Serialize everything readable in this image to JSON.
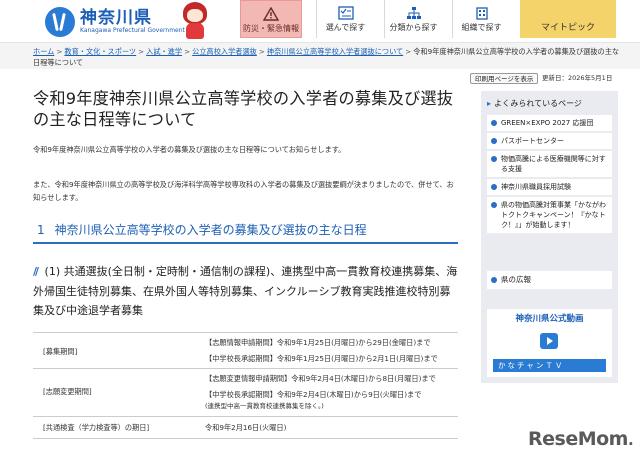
{
  "header": {
    "logo_jp": "神奈川県",
    "logo_en": "Kanagawa Prefectural Government",
    "nav": [
      {
        "label": "防災・緊急情報",
        "icon": "alert-icon"
      },
      {
        "label": "選んで探す",
        "icon": "checklist-icon"
      },
      {
        "label": "分類から探す",
        "icon": "tree-icon"
      },
      {
        "label": "組織で探す",
        "icon": "building-icon"
      },
      {
        "label": "マイトピック",
        "icon": "star-icon"
      }
    ]
  },
  "breadcrumb": {
    "items": [
      "ホーム",
      "教育・文化・スポーツ",
      "入試・進学",
      "公立高校入学者選抜",
      "神奈川県公立高等学校入学者選抜について"
    ],
    "current": "令和9年度神奈川県公立高等学校の入学者の募集及び選抜の主な日程等について"
  },
  "print_label": "印刷用ページを表示",
  "updated": "更新日：2026年5月1日",
  "page_title": "令和9年度神奈川県公立高等学校の入学者の募集及び選抜の主な日程等について",
  "intro": "令和9年度神奈川県公立高等学校の入学者の募集及び選抜の主な日程等についてお知らせします。",
  "intro2": "また、令和9年度神奈川県立の高等学校及び海洋科学高等学校専攻科の入学者の募集及び選抜要綱が決まりましたので、併せて、お知らせします。",
  "section": {
    "num": "1",
    "title": "神奈川県公立高等学校の入学者の募集及び選抜の主な日程"
  },
  "subsection": {
    "mark": "//",
    "num": "(1)",
    "title": "共通選抜(全日制・定時制・通信制の課程)、連携型中高一貫教育校連携募集、海外帰国生徒特別募集、在県外国人等特別募集、インクルーシブ教育実践推進校特別募集及び中途退学者募集"
  },
  "schedule": [
    {
      "label": "[募集期間]",
      "values": [
        "【志願情報申請期間】令和9年1月25日(月曜日)から29日(金曜日)まで",
        "【中学校長承認期間】令和9年1月25日(月曜日)から2月1日(月曜日)まで"
      ],
      "note": ""
    },
    {
      "label": "[志願変更期間]",
      "values": [
        "【志願変更情報申請期間】令和9年2月4日(木曜日)から8日(月曜日)まで",
        "【中学校長承認期間】令和9年2月4日(木曜日)から9日(火曜日)まで"
      ],
      "note": "(連携型中高一貫教育校連携募集を除く。)"
    },
    {
      "label": "[共通検査（学力検査等）の期日]",
      "values": [
        "令和9年2月16日(火曜日)"
      ],
      "note": ""
    }
  ],
  "sidebar": {
    "heading": "よくみられているページ",
    "items": [
      "GREEN×EXPO 2027 応援団",
      "パスポートセンター",
      "物価高騰による医療機関等に対する支援",
      "神奈川県職員採用試験",
      "県の物価高騰対策事業「かながわトクトクキャンペーン！『かなトク！』」が始動します！"
    ],
    "news": "県の広報",
    "video_title": "神奈川県公式動画",
    "video_bar": "かなチャンＴＶ"
  },
  "watermark": {
    "main": "ReseMom",
    "small": "."
  }
}
